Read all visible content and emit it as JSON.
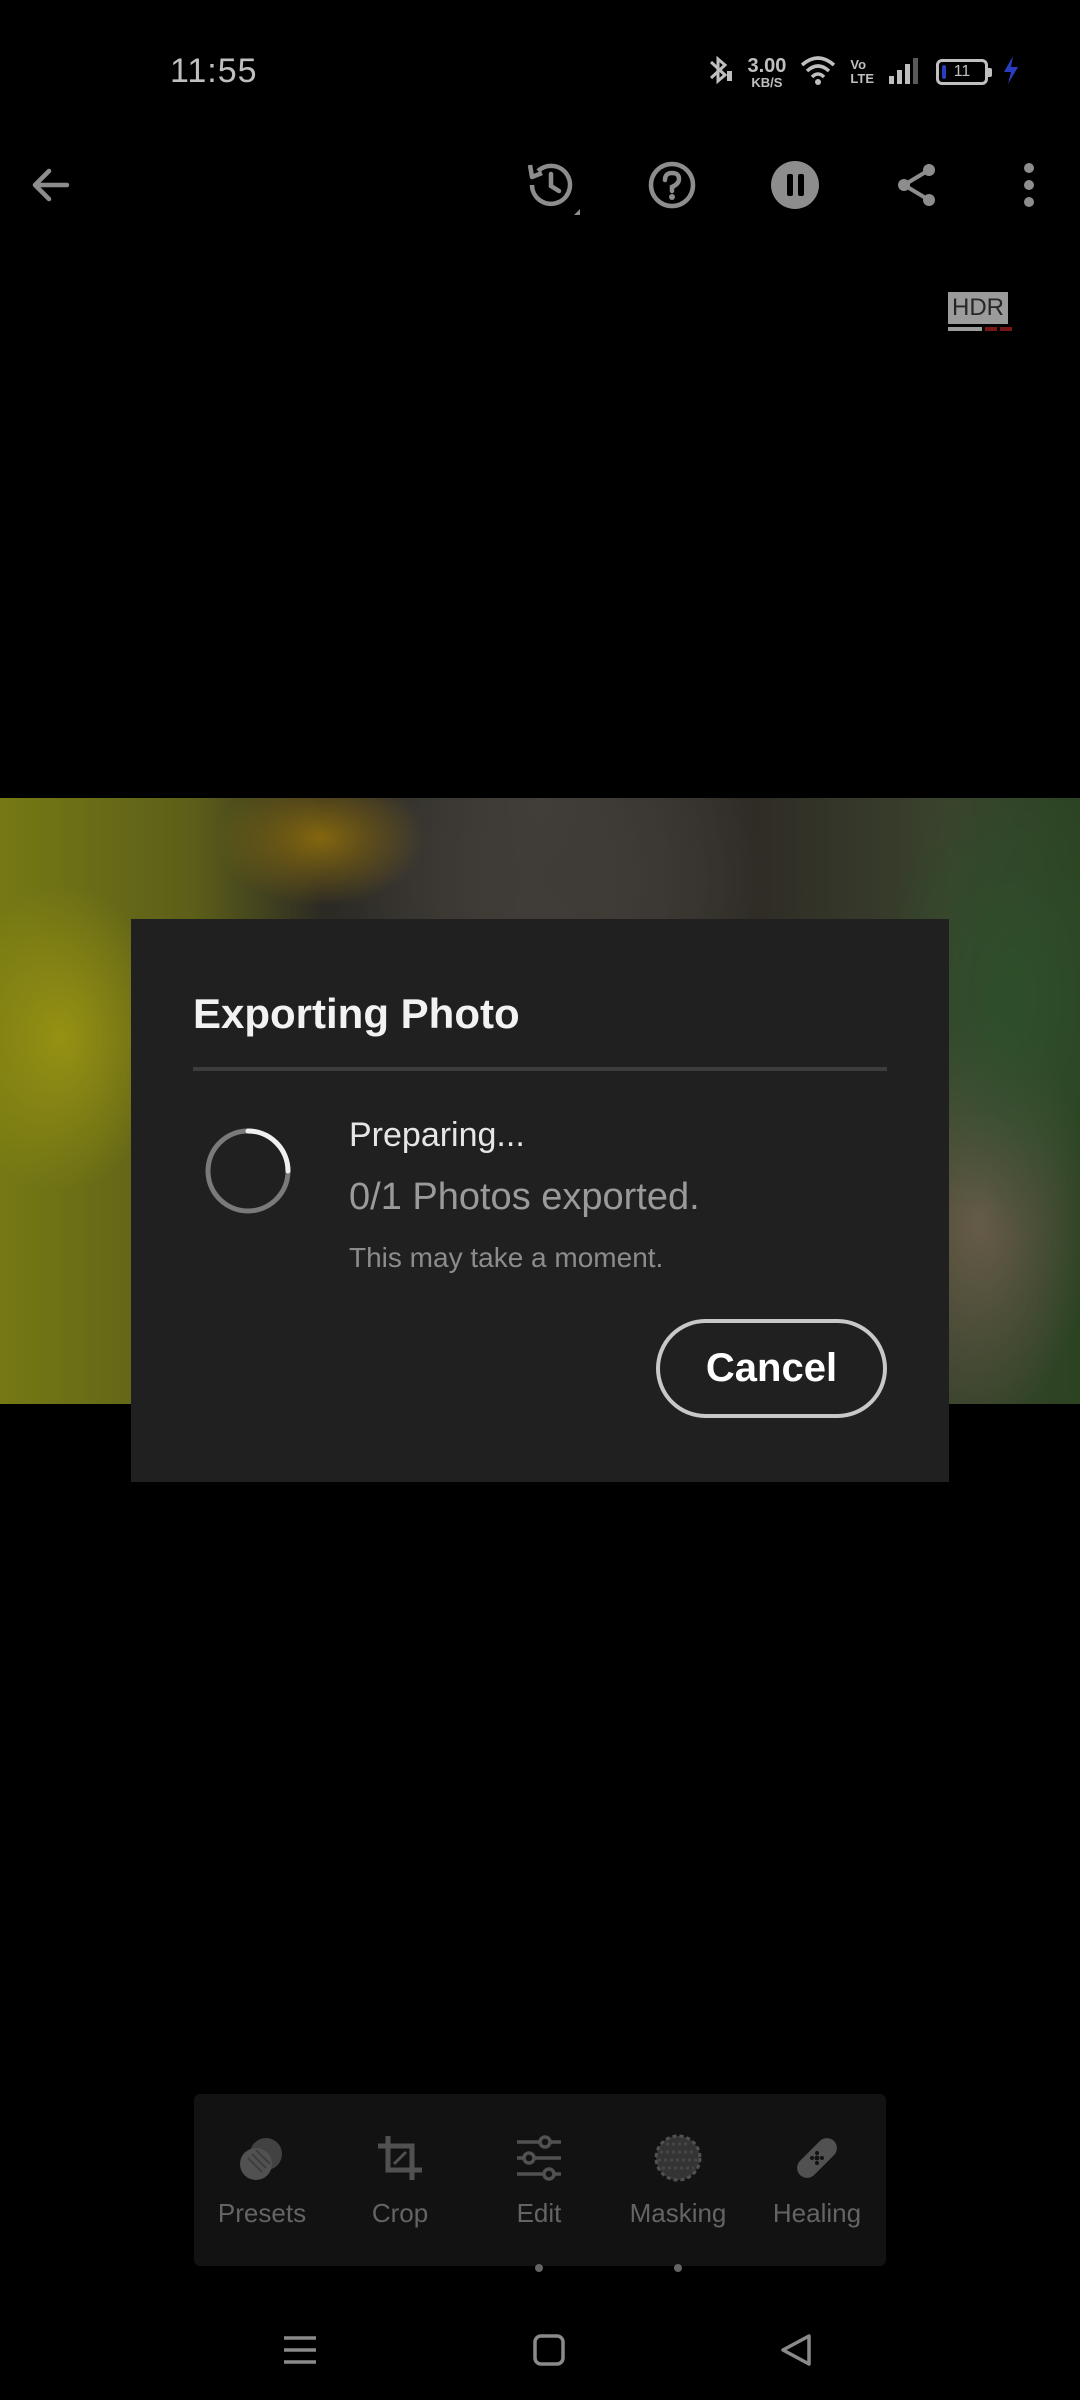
{
  "status_bar": {
    "time": "11:55",
    "net_speed_value": "3.00",
    "net_speed_unit": "KB/S",
    "volte_top": "Vo",
    "volte_bottom": "LTE",
    "battery_level": "11"
  },
  "toolbar": {
    "icons": [
      "back-arrow-icon",
      "history-icon",
      "help-icon",
      "pause-icon",
      "share-icon",
      "more-options-icon"
    ]
  },
  "hdr_badge": "HDR",
  "dialog": {
    "title": "Exporting Photo",
    "status": "Preparing...",
    "progress_text": "0/1 Photos exported.",
    "hint": "This may take a moment.",
    "cancel_label": "Cancel"
  },
  "tools": {
    "items": [
      {
        "label": "Presets",
        "icon": "presets-icon"
      },
      {
        "label": "Crop",
        "icon": "crop-icon"
      },
      {
        "label": "Edit",
        "icon": "edit-sliders-icon"
      },
      {
        "label": "Masking",
        "icon": "masking-icon"
      },
      {
        "label": "Healing",
        "icon": "healing-bandage-icon"
      }
    ]
  },
  "colors": {
    "dialog_bg": "#202020",
    "accent_blue": "#3a52ff",
    "hdr_red": "#a01c1c"
  }
}
